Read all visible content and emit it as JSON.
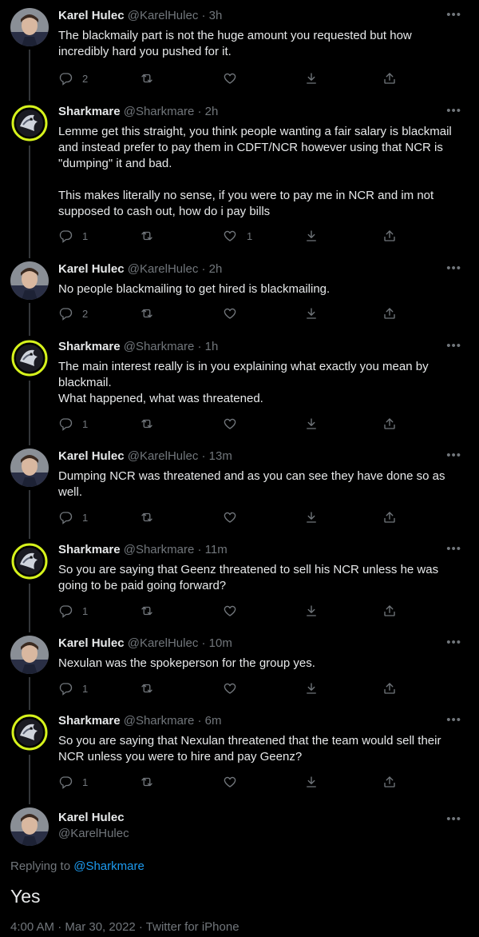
{
  "tweets": [
    {
      "name": "Karel Hulec",
      "handle": "@KarelHulec",
      "time": "3h",
      "text": "The blackmaily part is not the huge amount you requested but how\nincredibly hard you pushed for it.",
      "replies": "2",
      "likes": ""
    },
    {
      "name": "Sharkmare",
      "handle": "@Sharkmare",
      "time": "2h",
      "text": "Lemme get this straight, you think people wanting a fair salary is blackmail\nand instead prefer to pay them in CDFT/NCR however using that NCR is\n\"dumping\" it and bad.\n\nThis makes literally no sense, if you were to pay me in NCR and im not\nsupposed to cash out, how do i pay bills",
      "replies": "1",
      "likes": "1"
    },
    {
      "name": "Karel Hulec",
      "handle": "@KarelHulec",
      "time": "2h",
      "text": "No people blackmailing to get hired is blackmailing.",
      "replies": "2",
      "likes": ""
    },
    {
      "name": "Sharkmare",
      "handle": "@Sharkmare",
      "time": "1h",
      "text": "The main interest really is in you explaining what exactly you mean by\nblackmail.\nWhat happened, what was threatened.",
      "replies": "1",
      "likes": ""
    },
    {
      "name": "Karel Hulec",
      "handle": "@KarelHulec",
      "time": "13m",
      "text": "Dumping NCR was threatened and as you can see they have done so as\nwell.",
      "replies": "1",
      "likes": ""
    },
    {
      "name": "Sharkmare",
      "handle": "@Sharkmare",
      "time": "11m",
      "text": "So you are saying that Geenz threatened to sell his NCR unless he was\ngoing to be paid going forward?",
      "replies": "1",
      "likes": ""
    },
    {
      "name": "Karel Hulec",
      "handle": "@KarelHulec",
      "time": "10m",
      "text": "Nexulan was the spokeperson for the group yes.",
      "replies": "1",
      "likes": ""
    },
    {
      "name": "Sharkmare",
      "handle": "@Sharkmare",
      "time": "6m",
      "text": "So you are saying that Nexulan threatened that the team would sell their\nNCR unless you were to hire and pay Geenz?",
      "replies": "1",
      "likes": ""
    }
  ],
  "main_tweet": {
    "name": "Karel Hulec",
    "handle": "@KarelHulec",
    "replying_prefix": "Replying to",
    "replying_to": "@Sharkmare",
    "text": "Yes",
    "meta": "4:00 AM · Mar 30, 2022 · Twitter for iPhone"
  },
  "separator": " · ",
  "more_label": "•••",
  "colors": {
    "background": "#000000",
    "text": "#e7e9ea",
    "muted": "#71767b",
    "link": "#1d9bf0",
    "avatar_ring": "#d6f21c"
  },
  "icons": [
    "reply-icon",
    "retweet-icon",
    "like-icon",
    "download-icon",
    "share-icon",
    "more-icon"
  ]
}
